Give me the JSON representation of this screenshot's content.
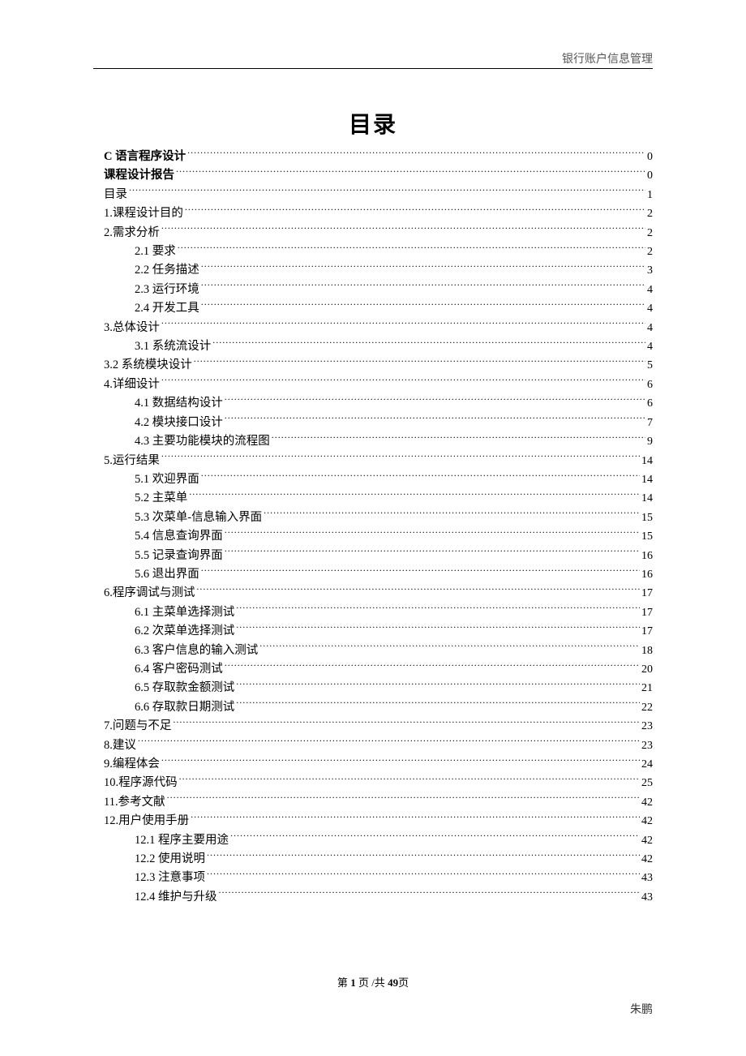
{
  "header": {
    "doc_title": "银行账户信息管理"
  },
  "title": "目录",
  "toc": [
    {
      "label": "C 语言程序设计",
      "page": "0",
      "indent": 0,
      "bold": true
    },
    {
      "label": "课程设计报告",
      "page": "0",
      "indent": 0,
      "bold": true
    },
    {
      "label": "目录",
      "page": "1",
      "indent": 0,
      "bold": false
    },
    {
      "label": "1.课程设计目的",
      "page": "2",
      "indent": 0,
      "bold": false
    },
    {
      "label": "2.需求分析",
      "page": "2",
      "indent": 0,
      "bold": false
    },
    {
      "label": "2.1 要求",
      "page": "2",
      "indent": 1,
      "bold": false
    },
    {
      "label": "2.2 任务描述",
      "page": "3",
      "indent": 1,
      "bold": false
    },
    {
      "label": "2.3 运行环境",
      "page": "4",
      "indent": 1,
      "bold": false
    },
    {
      "label": "2.4 开发工具",
      "page": "4",
      "indent": 1,
      "bold": false
    },
    {
      "label": "3.总体设计",
      "page": "4",
      "indent": 0,
      "bold": false
    },
    {
      "label": "3.1 系统流设计",
      "page": "4",
      "indent": 1,
      "bold": false
    },
    {
      "label": "3.2 系统模块设计",
      "page": "5",
      "indent": 0,
      "bold": false
    },
    {
      "label": "4.详细设计",
      "page": "6",
      "indent": 0,
      "bold": false
    },
    {
      "label": "4.1 数据结构设计",
      "page": "6",
      "indent": 1,
      "bold": false
    },
    {
      "label": "4.2  模块接口设计",
      "page": "7",
      "indent": 1,
      "bold": false
    },
    {
      "label": "4.3 主要功能模块的流程图",
      "page": "9",
      "indent": 1,
      "bold": false
    },
    {
      "label": "5.运行结果",
      "page": "14",
      "indent": 0,
      "bold": false
    },
    {
      "label": "5.1  欢迎界面",
      "page": "14",
      "indent": 1,
      "bold": false
    },
    {
      "label": "5.2  主菜单",
      "page": "14",
      "indent": 1,
      "bold": false
    },
    {
      "label": "5.3  次菜单-信息输入界面",
      "page": "15",
      "indent": 1,
      "bold": false
    },
    {
      "label": "5.4 信息查询界面",
      "page": "15",
      "indent": 1,
      "bold": false
    },
    {
      "label": "5.5 记录查询界面",
      "page": "16",
      "indent": 1,
      "bold": false
    },
    {
      "label": "5.6 退出界面",
      "page": "16",
      "indent": 1,
      "bold": false
    },
    {
      "label": "6.程序调试与测试",
      "page": "17",
      "indent": 0,
      "bold": false
    },
    {
      "label": "6.1 主菜单选择测试",
      "page": "17",
      "indent": 1,
      "bold": false
    },
    {
      "label": "6.2  次菜单选择测试",
      "page": "17",
      "indent": 1,
      "bold": false
    },
    {
      "label": "6.3 客户信息的输入测试",
      "page": "18",
      "indent": 1,
      "bold": false
    },
    {
      "label": "6.4 客户密码测试",
      "page": "20",
      "indent": 1,
      "bold": false
    },
    {
      "label": "6.5 存取款金额测试",
      "page": "21",
      "indent": 1,
      "bold": false
    },
    {
      "label": "6.6 存取款日期测试",
      "page": "22",
      "indent": 1,
      "bold": false
    },
    {
      "label": "7.问题与不足",
      "page": "23",
      "indent": 0,
      "bold": false
    },
    {
      "label": "8.建议",
      "page": "23",
      "indent": 0,
      "bold": false
    },
    {
      "label": "9.编程体会",
      "page": "24",
      "indent": 0,
      "bold": false
    },
    {
      "label": "10.程序源代码",
      "page": "25",
      "indent": 0,
      "bold": false
    },
    {
      "label": "11.参考文献",
      "page": "42",
      "indent": 0,
      "bold": false
    },
    {
      "label": "12.用户使用手册",
      "page": "42",
      "indent": 0,
      "bold": false
    },
    {
      "label": "12.1  程序主要用途",
      "page": "42",
      "indent": 1,
      "bold": false
    },
    {
      "label": "12.2 使用说明",
      "page": "42",
      "indent": 1,
      "bold": false
    },
    {
      "label": "12.3 注意事项",
      "page": "43",
      "indent": 1,
      "bold": false
    },
    {
      "label": "12.4 维护与升级",
      "page": "43",
      "indent": 1,
      "bold": false
    }
  ],
  "footer": {
    "page_prefix": "第 ",
    "page_current": "1",
    "page_middle": " 页  /共  ",
    "page_total": "49",
    "page_suffix": "页",
    "author": "朱鹏"
  }
}
